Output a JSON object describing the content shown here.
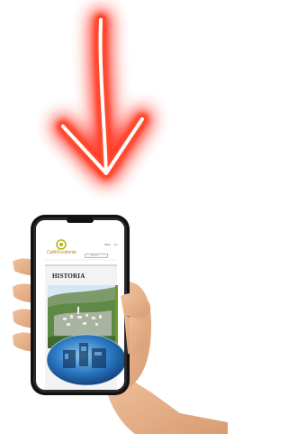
{
  "phone_screen": {
    "brand": "CaféOccidente",
    "nav_left": "Inicio",
    "nav_right": "Es",
    "search_placeholder": "Buscar",
    "heading": "HISTORIA"
  },
  "colors": {
    "arrow_glow": "#ff2a1a",
    "arrow_core": "#ffffff",
    "logo_ring": "#b5b51c",
    "brand_text": "#b4811c",
    "skin": "#e7b189"
  },
  "icons": [
    "down-arrow-icon",
    "cafe-occidente-logo-icon",
    "search-icon"
  ]
}
